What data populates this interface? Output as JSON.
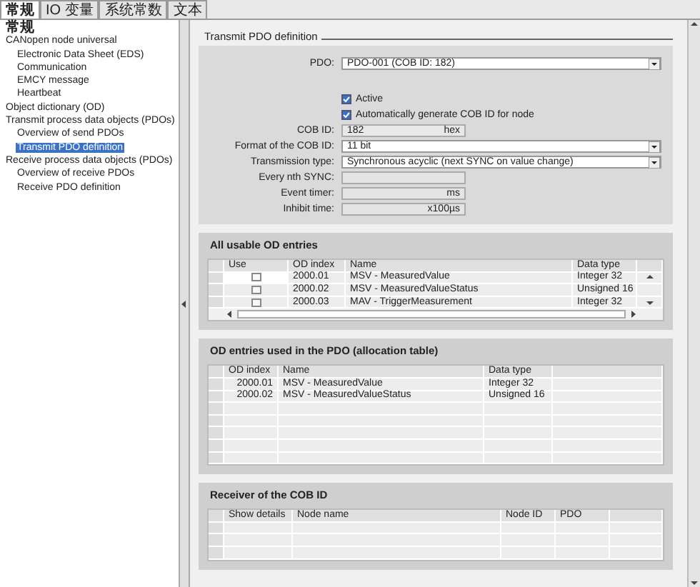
{
  "tabs": [
    {
      "label": "常规",
      "selected": true
    },
    {
      "label": "IO 变量",
      "selected": false
    },
    {
      "label": "系统常数",
      "selected": false
    },
    {
      "label": "文本",
      "selected": false
    }
  ],
  "tree": [
    {
      "label": "常规",
      "bold": true,
      "selected": false
    },
    {
      "label": "CANopen node universal",
      "selected": false,
      "children": [
        {
          "label": "Electronic Data Sheet (EDS)",
          "selected": false
        },
        {
          "label": "Communication",
          "selected": false
        },
        {
          "label": "EMCY message",
          "selected": false
        },
        {
          "label": "Heartbeat",
          "selected": false
        }
      ]
    },
    {
      "label": "Object dictionary (OD)",
      "selected": false
    },
    {
      "label": "Transmit process data objects (PDOs)",
      "selected": false,
      "children": [
        {
          "label": "Overview of send PDOs",
          "selected": false
        },
        {
          "label": "Transmit PDO definition",
          "selected": true
        }
      ]
    },
    {
      "label": "Receive process data objects (PDOs)",
      "selected": false,
      "children": [
        {
          "label": "Overview of receive PDOs",
          "selected": false
        },
        {
          "label": "Receive PDO definition",
          "selected": false
        }
      ]
    }
  ],
  "section_title": "Transmit PDO definition",
  "form": [
    {
      "kind": "dropdown",
      "label": "PDO:",
      "value": "PDO-001 (COB ID: 182)"
    },
    {
      "kind": "gap"
    },
    {
      "kind": "checkbox",
      "label": "Active",
      "checked": true
    },
    {
      "kind": "checkbox",
      "label": "Automatically generate COB ID for node",
      "checked": true
    },
    {
      "kind": "field",
      "label": "COB ID:",
      "value": "182",
      "unit": "hex"
    },
    {
      "kind": "dropdown",
      "label": "Format of the COB ID:",
      "value": "11 bit"
    },
    {
      "kind": "dropdown",
      "label": "Transmission type:",
      "value": "Synchronous acyclic (next SYNC on value change)"
    },
    {
      "kind": "field",
      "label": "Every nth SYNC:"
    },
    {
      "kind": "field",
      "label": "Event timer:",
      "unit": "ms"
    },
    {
      "kind": "field",
      "label": "Inhibit time:",
      "unit": "x100µs"
    }
  ],
  "usable_entries": {
    "title": "All usable OD entries",
    "columns": [
      "Use",
      "OD index",
      "Name",
      "Data type"
    ],
    "rows": [
      {
        "checked": false,
        "index": "2000.01",
        "name": "MSV - MeasuredValue",
        "type": "Integer 32"
      },
      {
        "checked": false,
        "index": "2000.02",
        "name": "MSV - MeasuredValueStatus",
        "type": "Unsigned 16"
      },
      {
        "checked": false,
        "index": "2000.03",
        "name": "MAV - TriggerMeasurement",
        "type": "Integer 32"
      }
    ]
  },
  "allocation": {
    "title": "OD entries used in the PDO (allocation table)",
    "columns": [
      "OD index",
      "Name",
      "Data type"
    ],
    "rows": [
      {
        "index": "2000.01",
        "name": "MSV - MeasuredValue",
        "type": "Integer 32"
      },
      {
        "index": "2000.02",
        "name": "MSV - MeasuredValueStatus",
        "type": "Unsigned 16"
      }
    ]
  },
  "receiver": {
    "title": "Receiver of the COB ID",
    "columns": [
      "Show details",
      "Node name",
      "Node ID",
      "PDO"
    ]
  }
}
